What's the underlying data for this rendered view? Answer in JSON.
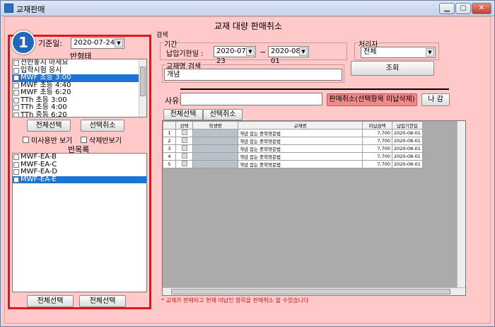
{
  "window": {
    "title": "교재판매"
  },
  "heading": "교재 대량 판매취소",
  "left": {
    "date_label": "기준일:",
    "date_value": "2020-07-24",
    "class_label": "반형태",
    "class_items": [
      {
        "label": "선반놓지 마세요",
        "checked": false,
        "selected": false
      },
      {
        "label": "입학시험 응시",
        "checked": false,
        "selected": false
      },
      {
        "label": "MWF 초등 3:00",
        "checked": false,
        "selected": true
      },
      {
        "label": "MWF 초등 4:40",
        "checked": false,
        "selected": false
      },
      {
        "label": "MWF 초등 6:20",
        "checked": false,
        "selected": false
      },
      {
        "label": "TTh 초등 3:00",
        "checked": false,
        "selected": false
      },
      {
        "label": "TTh 초등 4:00",
        "checked": false,
        "selected": false
      },
      {
        "label": "TTh 중등 6:20",
        "checked": false,
        "selected": false
      }
    ],
    "select_all_label": "전체선택",
    "deselect_label": "선택취소",
    "unused_label": "미사용반 보기",
    "deleted_label": "삭제반보기",
    "sub_label": "반목록",
    "sub_items": [
      {
        "label": "MWF-EA-B",
        "checked": false,
        "selected": false
      },
      {
        "label": "MWF-EA-C",
        "checked": false,
        "selected": false
      },
      {
        "label": "MWF-EA-D",
        "checked": false,
        "selected": false
      },
      {
        "label": "MWF-EA-E",
        "checked": true,
        "selected": true
      }
    ],
    "bottom_btn1": "전체선택",
    "bottom_btn2": "전체선택",
    "badge": "1"
  },
  "right": {
    "search_title": "검색",
    "period_title": "기간",
    "due_label": "납입기한일 :",
    "date_from": "2020-07-23",
    "tilde": "~",
    "date_to": "2020-08-01",
    "handler_title": "처리자",
    "handler_value": "전체",
    "book_title": "교재명 검색",
    "book_value": "개념",
    "search_btn": "조회",
    "reason_label": "사유:",
    "cancel_btn": "판매취소(선택항목 미납삭제)",
    "exit_btn": "나 감",
    "select_all_btn": "전체선택",
    "deselect_btn": "선택취소",
    "grid": {
      "headers": [
        "선택",
        "학생명",
        "교재명",
        "미납금액",
        "납입기한일"
      ],
      "rows": [
        {
          "no": "1",
          "name": "",
          "book": "개념 잡는 중학영문법",
          "amount": "7,700",
          "due": "2020-08-01"
        },
        {
          "no": "2",
          "name": "",
          "book": "개념 잡는 중학영문법",
          "amount": "7,700",
          "due": "2020-08-01"
        },
        {
          "no": "3",
          "name": "",
          "book": "개념 잡는 중학영문법",
          "amount": "7,700",
          "due": "2020-08-01"
        },
        {
          "no": "4",
          "name": "",
          "book": "개념 잡는 중학영문법",
          "amount": "7,700",
          "due": "2020-08-01"
        },
        {
          "no": "5",
          "name": "",
          "book": "개념 잡는 중학영문법",
          "amount": "7,700",
          "due": "2020-08-01"
        }
      ]
    },
    "notice": "* 교재가 판매되고 현재 미납인 항목을 판매취소 할 수있습니다"
  },
  "colors": {
    "background": "#ffc9c9",
    "highlight": "#e0161b",
    "selection": "#1c74d6",
    "cancel_button": "#f08a8a"
  }
}
